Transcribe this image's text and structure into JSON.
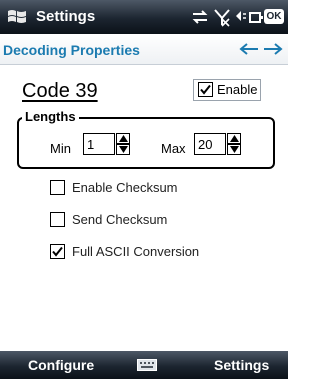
{
  "titlebar": {
    "app_title": "Settings",
    "ok_label": "OK"
  },
  "header": {
    "title": "Decoding Properties"
  },
  "symbology": {
    "name": "Code 39",
    "enable_label": "Enable",
    "enable_checked": true
  },
  "lengths": {
    "legend": "Lengths",
    "min_label": "Min",
    "min_value": "1",
    "max_label": "Max",
    "max_value": "20"
  },
  "options": [
    {
      "label": "Enable Checksum",
      "checked": false
    },
    {
      "label": "Send Checksum",
      "checked": false
    },
    {
      "label": "Full ASCII Conversion",
      "checked": true
    }
  ],
  "bottombar": {
    "left_softkey": "Configure",
    "right_softkey": "Settings"
  },
  "colors": {
    "header_text": "#1b7bb0",
    "bar_dark": "#1c2530"
  }
}
